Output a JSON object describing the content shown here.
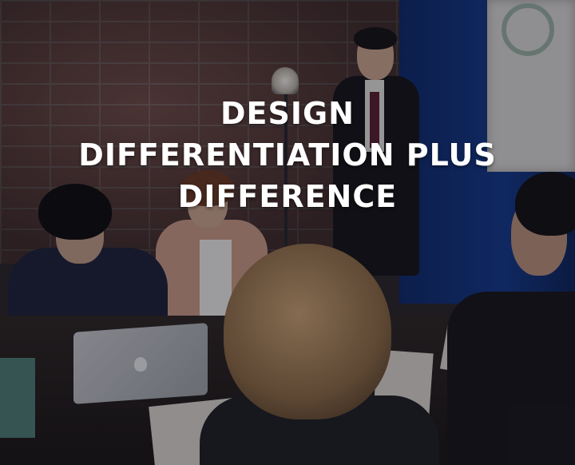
{
  "headline": {
    "line1": "DESIGN",
    "line2": "DIFFERENTIATION PLUS",
    "line3": "DIFFERENCE"
  }
}
